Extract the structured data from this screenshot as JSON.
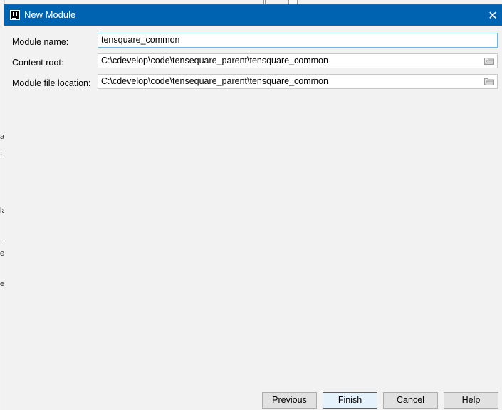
{
  "window": {
    "title": "New Module",
    "close_glyph": "✕"
  },
  "form": {
    "module_name": {
      "label": "Module name:",
      "value": "tensquare_common"
    },
    "content_root": {
      "label": "Content root:",
      "value": "C:\\cdevelop\\code\\tensequare_parent\\tensquare_common",
      "browse_icon": "folder-icon"
    },
    "module_file_location": {
      "label": "Module file location:",
      "value": "C:\\cdevelop\\code\\tensequare_parent\\tensquare_common",
      "browse_icon": "folder-icon"
    }
  },
  "buttons": {
    "previous": {
      "mnemonic": "P",
      "rest": "revious"
    },
    "finish": {
      "mnemonic": "F",
      "rest": "inish"
    },
    "cancel": "Cancel",
    "help": "Help"
  },
  "background_fragments": [
    "a",
    "I",
    "la",
    ".",
    "e",
    "e:"
  ],
  "colors": {
    "titlebar": "#0063b1",
    "dialog_bg": "#f2f2f2",
    "focused_border": "#6fb6e6",
    "default_button_border": "#0078d7"
  }
}
